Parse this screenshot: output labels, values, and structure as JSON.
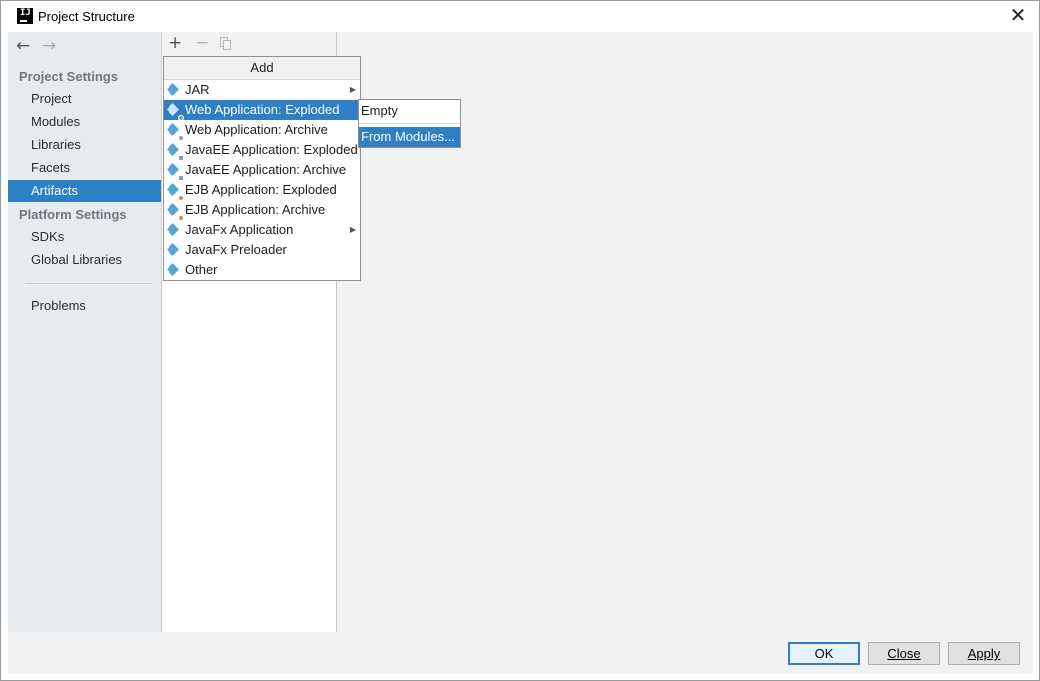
{
  "window": {
    "title": "Project Structure",
    "app_icon": "intellij-logo-icon",
    "app_icon_text": "IJ"
  },
  "nav": {
    "back": "←",
    "forward": "→"
  },
  "sidebar": {
    "project_settings_header": "Project Settings",
    "project_items": [
      {
        "label": "Project"
      },
      {
        "label": "Modules"
      },
      {
        "label": "Libraries"
      },
      {
        "label": "Facets"
      },
      {
        "label": "Artifacts",
        "selected": true
      }
    ],
    "platform_settings_header": "Platform Settings",
    "platform_items": [
      {
        "label": "SDKs"
      },
      {
        "label": "Global Libraries"
      }
    ],
    "problems": "Problems"
  },
  "toolbar": {
    "add": "+",
    "remove": "−",
    "copy_icon": "copy-icon"
  },
  "add_popup": {
    "header": "Add",
    "items": [
      {
        "label": "JAR",
        "has_submenu": true
      },
      {
        "label": "Web Application: Exploded",
        "highlighted": true
      },
      {
        "label": "Web Application: Archive"
      },
      {
        "label": "JavaEE Application: Exploded"
      },
      {
        "label": "JavaEE Application: Archive"
      },
      {
        "label": "EJB Application: Exploded"
      },
      {
        "label": "EJB Application: Archive"
      },
      {
        "label": "JavaFx Application",
        "has_submenu": true
      },
      {
        "label": "JavaFx Preloader"
      },
      {
        "label": "Other"
      }
    ],
    "submenu_arrow": "▶"
  },
  "submenu": {
    "items": [
      {
        "label": "Empty"
      },
      {
        "label": "From Modules...",
        "highlighted": true
      }
    ]
  },
  "buttons": {
    "ok": "OK",
    "close": "Close",
    "apply": "Apply"
  },
  "colors": {
    "selection": "#2f7fc4",
    "sidebar_bg": "#e8ebee",
    "artifact_icon": "#58a6d6"
  }
}
